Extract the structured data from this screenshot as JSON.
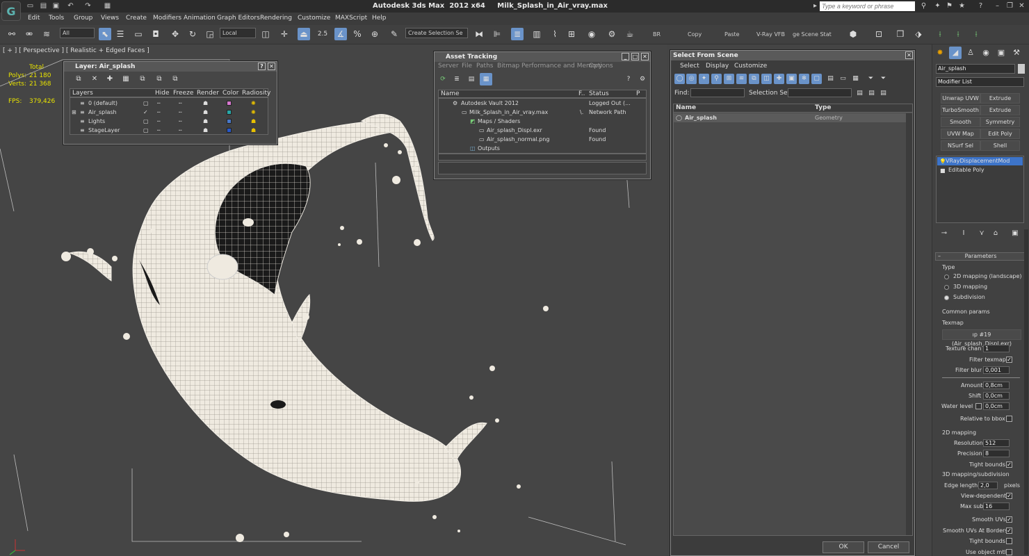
{
  "app": {
    "title": "Autodesk 3ds Max  2012 x64     Milk_Splash_in_Air_vray.max",
    "search_placeholder": "Type a keyword or phrase"
  },
  "menu": [
    "Edit",
    "Tools",
    "Group",
    "Views",
    "Create",
    "Modifiers",
    "Animation",
    "Graph Editors",
    "Rendering",
    "Customize",
    "MAXScript",
    "Help"
  ],
  "toolbar": {
    "filter_value": "All",
    "coord_value": "Local",
    "snap_value": "2.5",
    "selection_set_placeholder": "Create Selection Se",
    "labels": [
      "BR",
      "Copy",
      "Paste",
      "V-Ray VFB",
      "ge Scene Stat"
    ]
  },
  "viewport": {
    "label": "[ + ] [ Perspective ] [ Realistic + Edged Faces ]",
    "stats": {
      "total_label": "Total",
      "polys_label": "Polys:",
      "polys_value": "21 180",
      "verts_label": "Verts:",
      "verts_value": "21 368",
      "fps_label": "FPS:",
      "fps_value": "379,426"
    }
  },
  "layer_window": {
    "title": "Layer: Air_splash",
    "columns": [
      "Layers",
      "Hide",
      "Freeze",
      "Render",
      "Color",
      "Radiosity"
    ],
    "rows": [
      {
        "name": "0 (default)",
        "color": "#d878d0"
      },
      {
        "name": "Air_splash",
        "color": "#28a8a8"
      },
      {
        "name": "Lights",
        "color": "#4878c8"
      },
      {
        "name": "StageLayer",
        "color": "#2858c8"
      }
    ]
  },
  "asset_window": {
    "title": "Asset Tracking",
    "menu": [
      "Server",
      "File",
      "Paths",
      "Bitmap Performance and Memory",
      "Options"
    ],
    "columns": [
      "Name",
      "F..",
      "Status",
      "P"
    ],
    "rows": [
      {
        "name": "Autodesk Vault 2012",
        "f": "",
        "status": "Logged Out (..."
      },
      {
        "name": "Milk_Splash_in_Air_vray.max",
        "f": "\\.",
        "status": "Network Path"
      },
      {
        "name": "Maps / Shaders",
        "f": "",
        "status": ""
      },
      {
        "name": "Air_splash_Displ.exr",
        "f": "",
        "status": "Found"
      },
      {
        "name": "Air_splash_normal.png",
        "f": "",
        "status": "Found"
      },
      {
        "name": "Outputs",
        "f": "",
        "status": ""
      }
    ]
  },
  "select_window": {
    "title": "Select From Scene",
    "menu": [
      "Select",
      "Display",
      "Customize"
    ],
    "find_label": "Find:",
    "selset_label": "Selection Set:",
    "columns": [
      "Name",
      "Type"
    ],
    "rows": [
      {
        "name": "Air_splash",
        "type": "Geometry"
      }
    ],
    "ok": "OK",
    "cancel": "Cancel"
  },
  "command_panel": {
    "object_name": "Air_splash",
    "modifier_list": "Modifier List",
    "buttons": [
      "Unwrap UVW",
      "Extrude",
      "TurboSmooth",
      "Extrude",
      "Smooth",
      "Symmetry",
      "UVW Map",
      "Edit Poly",
      "NSurf Sel",
      "Shell"
    ],
    "stack": [
      "VRayDisplacementMod",
      "Editable Poly"
    ],
    "rollout": "Parameters",
    "type_label": "Type",
    "type_options": [
      "2D mapping (landscape)",
      "3D mapping",
      "Subdivision"
    ],
    "common_label": "Common params",
    "texmap_label": "Texmap",
    "texmap_value": "ıp #19 (Air_splash_Displ.exr)",
    "fields": [
      {
        "label": "Texture chan",
        "value": "1"
      },
      {
        "label": "Filter texmap",
        "check": "✓"
      },
      {
        "label": "Filter blur",
        "value": "0,001"
      },
      {
        "label": "Amount",
        "value": "0,8cm"
      },
      {
        "label": "Shift",
        "value": "0,0cm"
      },
      {
        "label": "Water level",
        "value": "0,0cm"
      },
      {
        "label": "Relative to bbox"
      }
    ],
    "map2d_label": "2D mapping",
    "map2d": [
      {
        "label": "Resolution",
        "value": "512"
      },
      {
        "label": "Precision",
        "value": "8"
      },
      {
        "label": "Tight bounds",
        "check": "✓"
      }
    ],
    "map3d_label": "3D mapping/subdivision",
    "edge_label": "Edge length",
    "edge_value": "2,0",
    "pixels": "pixels",
    "map3d": [
      {
        "label": "View-dependent",
        "check": "✓"
      },
      {
        "label": "Max subdivs",
        "value": "16"
      },
      {
        "label": "Smooth UVs",
        "check": "✓"
      },
      {
        "label": "Smooth UVs At Borders",
        "check": "✓"
      },
      {
        "label": "Tight bounds"
      },
      {
        "label": "Use object mtl"
      }
    ]
  }
}
